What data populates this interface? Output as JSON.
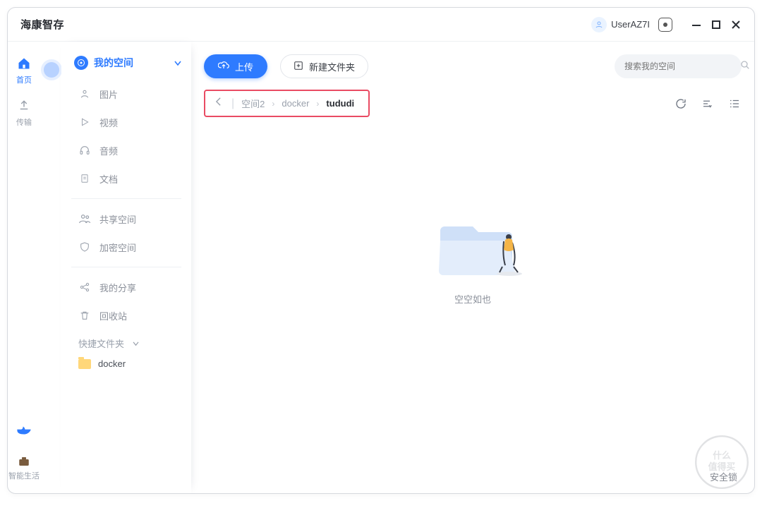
{
  "app": {
    "title": "海康智存",
    "user_name": "UserAZ7I"
  },
  "window_controls": {
    "minimize": "minimize",
    "maximize": "maximize",
    "close": "close"
  },
  "rail": {
    "items": [
      {
        "name": "home",
        "label": "首页",
        "active": true
      },
      {
        "name": "transfer",
        "label": "传输",
        "active": false
      }
    ],
    "bottom_items": [
      {
        "name": "whale",
        "label": "",
        "active": false
      },
      {
        "name": "smartlife",
        "label": "智能生活",
        "active": false
      }
    ]
  },
  "sidebar": {
    "space_label": "我的空间",
    "nav": [
      {
        "name": "pictures",
        "label": "图片"
      },
      {
        "name": "videos",
        "label": "视频"
      },
      {
        "name": "audio",
        "label": "音频"
      },
      {
        "name": "documents",
        "label": "文档"
      }
    ],
    "groups": [
      {
        "name": "shared",
        "label": "共享空间"
      },
      {
        "name": "encrypted",
        "label": "加密空间"
      }
    ],
    "actions": [
      {
        "name": "myshares",
        "label": "我的分享"
      },
      {
        "name": "recycle",
        "label": "回收站"
      }
    ],
    "quick": {
      "label": "快捷文件夹",
      "items": [
        {
          "name": "docker",
          "label": "docker"
        }
      ]
    }
  },
  "toolbar": {
    "upload_label": "上传",
    "newfolder_label": "新建文件夹"
  },
  "search": {
    "placeholder": "搜索我的空间"
  },
  "breadcrumb": {
    "items": [
      {
        "label": "空间2",
        "final": false
      },
      {
        "label": "docker",
        "final": false
      },
      {
        "label": "tududi",
        "final": true
      }
    ]
  },
  "empty_state": {
    "label": "空空如也"
  },
  "footer": {
    "security_lock": "安全锁"
  },
  "watermark_text": "什么值得买"
}
